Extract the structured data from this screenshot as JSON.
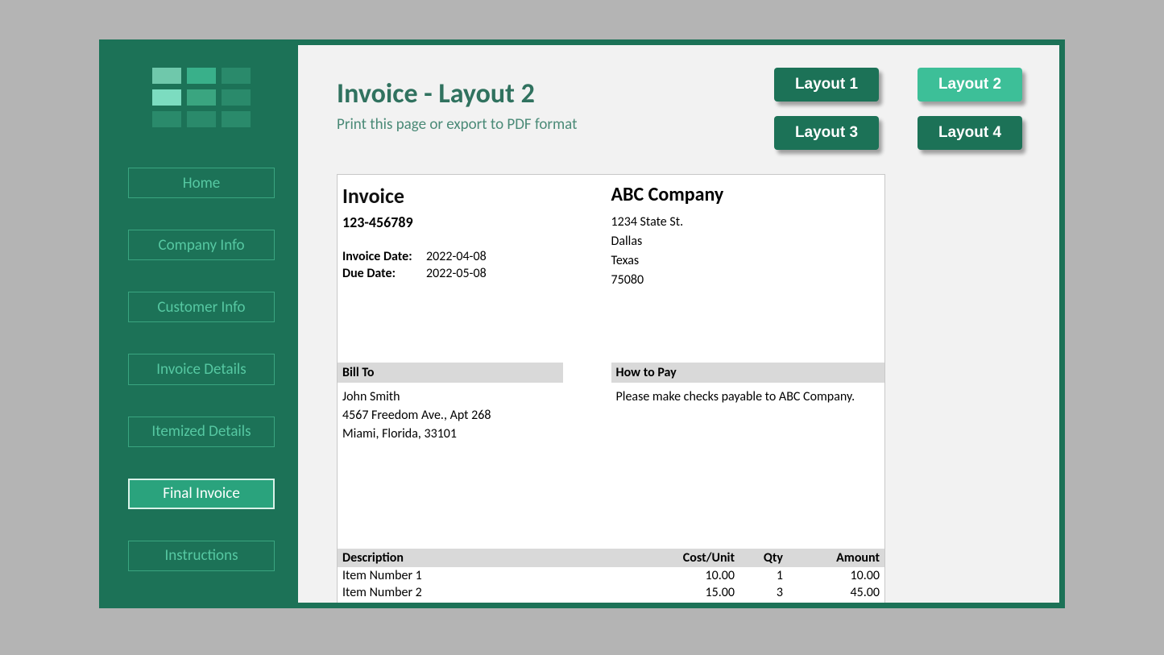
{
  "sidebar": {
    "items": [
      {
        "label": "Home",
        "active": false
      },
      {
        "label": "Company Info",
        "active": false
      },
      {
        "label": "Customer Info",
        "active": false
      },
      {
        "label": "Invoice Details",
        "active": false
      },
      {
        "label": "Itemized Details",
        "active": false
      },
      {
        "label": "Final Invoice",
        "active": true
      },
      {
        "label": "Instructions",
        "active": false
      }
    ]
  },
  "header": {
    "title": "Invoice - Layout 2",
    "subtitle": "Print this page or export to PDF format"
  },
  "layouts": {
    "buttons": [
      {
        "label": "Layout 1",
        "active": false
      },
      {
        "label": "Layout 2",
        "active": true
      },
      {
        "label": "Layout 3",
        "active": false
      },
      {
        "label": "Layout 4",
        "active": false
      }
    ]
  },
  "invoice": {
    "heading": "Invoice",
    "number": "123-456789",
    "date_label": "Invoice Date:",
    "date_value": "2022-04-08",
    "due_label": "Due Date:",
    "due_value": "2022-05-08",
    "company": {
      "name": "ABC Company",
      "line1": "1234 State St.",
      "line2": "Dallas",
      "line3": "Texas",
      "line4": "75080"
    },
    "bill_to_heading": "Bill To",
    "bill_to": {
      "line1": "John Smith",
      "line2": "4567 Freedom Ave., Apt 268",
      "line3": "Miami, Florida, 33101"
    },
    "pay_heading": "How to Pay",
    "pay_body": "Please make checks payable to ABC Company.",
    "columns": {
      "desc": "Description",
      "cost": "Cost/Unit",
      "qty": "Qty",
      "amount": "Amount"
    },
    "items": [
      {
        "desc": "Item Number 1",
        "cost": "10.00",
        "qty": "1",
        "amount": "10.00"
      },
      {
        "desc": "Item Number 2",
        "cost": "15.00",
        "qty": "3",
        "amount": "45.00"
      }
    ]
  }
}
